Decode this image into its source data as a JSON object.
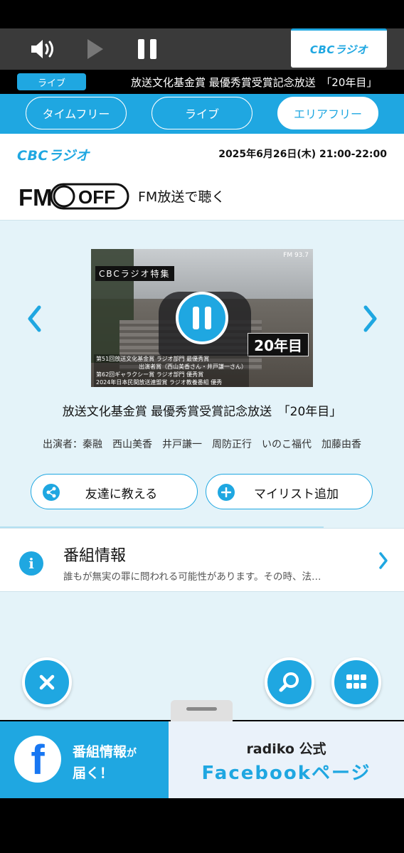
{
  "player": {
    "station": "CBCラジオ"
  },
  "now_playing": {
    "badge": "ライブ",
    "title": "放送文化基金賞 最優秀賞受賞記念放送　「20年目」"
  },
  "tabs": [
    {
      "label": "タイムフリー"
    },
    {
      "label": "ライブ"
    },
    {
      "label": "エリアフリー"
    }
  ],
  "station_header": {
    "logo": "CBCラジオ",
    "air_time": "2025年6月26日(木) 21:00-22:00",
    "fm_toggle_fm": "FM",
    "fm_toggle_off": "OFF",
    "fm_label": "FM放送で聴く"
  },
  "program": {
    "thumb_tag": "CBCラジオ特集",
    "thumb_freq": "FM 93.7",
    "thumb_badge": "20年目",
    "thumb_credits_1": "第51回放送文化基金賞 ラジオ部門 最優秀賞",
    "thumb_credits_2": "出演者賞（西山美香さん・井戸謙一さん）",
    "thumb_credits_3": "第62回ギャラクシー賞 ラジオ部門 優秀賞",
    "thumb_credits_4": "2024年日本民間放送連盟賞 ラジオ教養番組 優秀",
    "title": "放送文化基金賞 最優秀賞受賞記念放送　「20年目」",
    "performers": "出演者：秦融　西山美香　井戸謙一　周防正行　いのこ福代　加藤由香"
  },
  "actions": {
    "share_label": "友達に教える",
    "mylist_label": "マイリスト追加"
  },
  "info": {
    "title": "番組情報",
    "desc": "誰もが無実の罪に問われる可能性があります。その時、法…"
  },
  "banner": {
    "fb_letter": "f",
    "left_line1": "番組情報",
    "left_line1_small": "が",
    "left_line2": "届く！",
    "right_line1": "radiko 公式",
    "right_line2": "Facebookページ"
  },
  "colors": {
    "accent": "#1fa7e1",
    "dark_bar": "#3a3a3a",
    "main_bg": "#e4f3f9"
  }
}
